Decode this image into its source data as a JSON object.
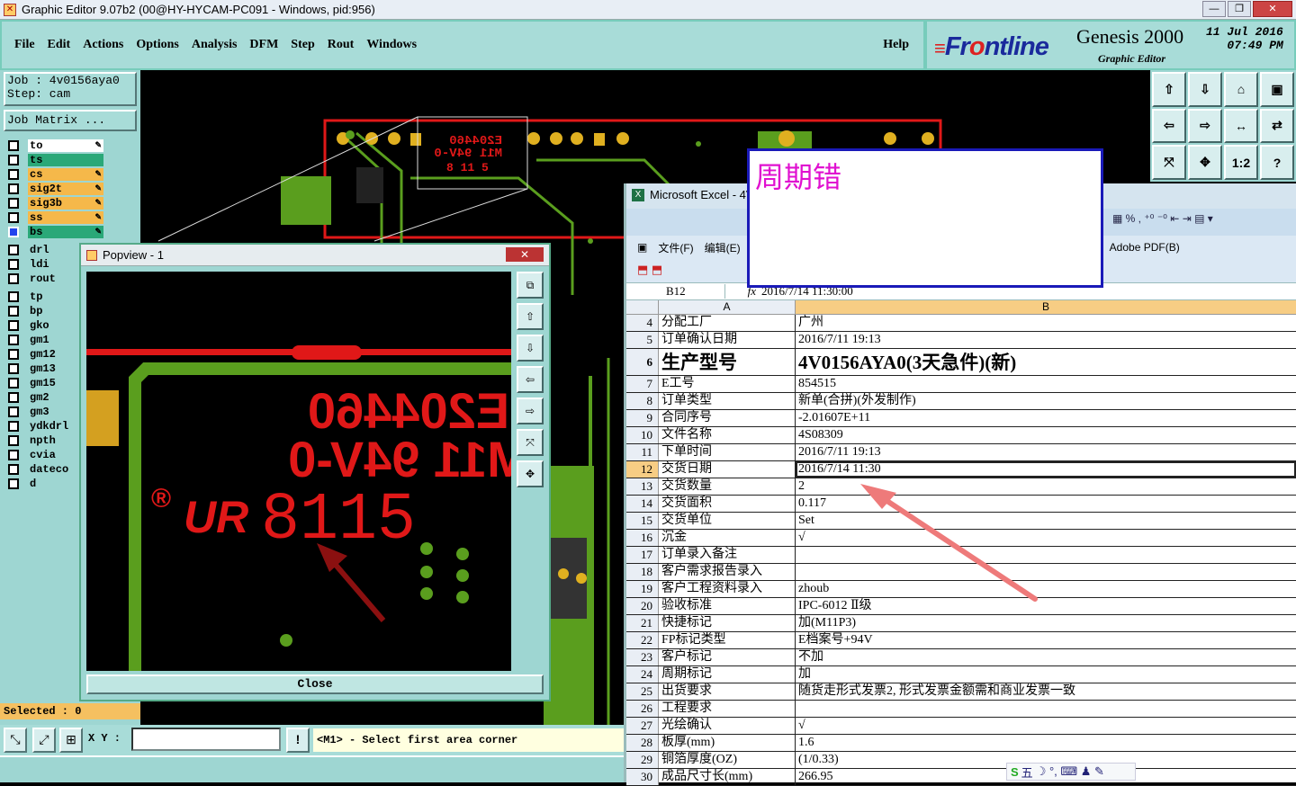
{
  "window": {
    "title": "Graphic Editor 9.07b2 (00@HY-HYCAM-PC091 - Windows, pid:956)",
    "minimize": "—",
    "restore": "❐",
    "close": "✕"
  },
  "menu": {
    "items": [
      "File",
      "Edit",
      "Actions",
      "Options",
      "Analysis",
      "DFM",
      "Step",
      "Rout",
      "Windows"
    ],
    "help": "Help"
  },
  "brand": {
    "logo_prefix": "Fr",
    "logo_o": "o",
    "logo_suffix": "ntline",
    "product": "Genesis 2000",
    "subtitle": "Graphic Editor",
    "date_line1": "11 Jul 2016",
    "date_line2": "07:49 PM"
  },
  "job": {
    "label": "Job : 4v0156aya0",
    "step": "Step: cam",
    "matrix": "Job Matrix ..."
  },
  "layers": [
    {
      "name": "to",
      "style": "white",
      "edit": true
    },
    {
      "name": "ts",
      "style": "green",
      "edit": false
    },
    {
      "name": "cs",
      "style": "active",
      "edit": true
    },
    {
      "name": "sig2t",
      "style": "active",
      "edit": true
    },
    {
      "name": "sig3b",
      "style": "active",
      "edit": true
    },
    {
      "name": "ss",
      "style": "active",
      "edit": true
    },
    {
      "name": "bs",
      "style": "green",
      "edit": true,
      "checked": true
    },
    {
      "name": "drl",
      "style": "none"
    },
    {
      "name": "ldi",
      "style": "none"
    },
    {
      "name": "rout",
      "style": "none"
    },
    {
      "name": "tp",
      "style": "none"
    },
    {
      "name": "bp",
      "style": "none"
    },
    {
      "name": "gko",
      "style": "none"
    },
    {
      "name": "gm1",
      "style": "none"
    },
    {
      "name": "gm12",
      "style": "none"
    },
    {
      "name": "gm13",
      "style": "none"
    },
    {
      "name": "gm15",
      "style": "none"
    },
    {
      "name": "gm2",
      "style": "none"
    },
    {
      "name": "gm3",
      "style": "none"
    },
    {
      "name": "ydkdrl",
      "style": "none"
    },
    {
      "name": "npth",
      "style": "none"
    },
    {
      "name": "cvia",
      "style": "none"
    },
    {
      "name": "dateco",
      "style": "none"
    },
    {
      "name": "d",
      "style": "none"
    }
  ],
  "status": {
    "selected": "Selected : 0",
    "xy_label": "X Y :",
    "xy_value": "",
    "message": "<M1> - Select first area corner",
    "alert": "!"
  },
  "popview": {
    "title": "Popview - 1",
    "close_x": "✕",
    "close_button": "Close",
    "marking_line1": "E204460",
    "marking_line2": "M11 94V-0",
    "marking_line3": "8115",
    "ul_mark": "UR",
    "reg_mark": "®"
  },
  "canvas_marking": {
    "line1": "E204460",
    "line2": "M11 94V-0",
    "small": "8 11 5"
  },
  "excel": {
    "title": "Microsoft Excel - 4V",
    "menu": [
      "文件(F)",
      "编辑(E)"
    ],
    "adobe": "Adobe PDF(B)",
    "namebox": "B12",
    "fx": "fx",
    "formula": "2016/7/14  11:30:00",
    "col_a": "A",
    "col_b": "B",
    "rows": [
      {
        "n": "4",
        "a": "分配工厂",
        "b": "广州"
      },
      {
        "n": "5",
        "a": "订单确认日期",
        "b": "2016/7/11 19:13"
      },
      {
        "n": "6",
        "a": "生产型号",
        "b": "4V0156AYA0(3天急件)(新)",
        "tall": true
      },
      {
        "n": "7",
        "a": "E工号",
        "b": "854515"
      },
      {
        "n": "8",
        "a": "订单类型",
        "b": "新单(合拼)(外发制作)"
      },
      {
        "n": "9",
        "a": "合同序号",
        "b": "-2.01607E+11"
      },
      {
        "n": "10",
        "a": "文件名称",
        "b": "4S08309"
      },
      {
        "n": "11",
        "a": "下单时间",
        "b": "2016/7/11 19:13"
      },
      {
        "n": "12",
        "a": "交货日期",
        "b": "2016/7/14 11:30",
        "sel": true
      },
      {
        "n": "13",
        "a": "交货数量",
        "b": "2"
      },
      {
        "n": "14",
        "a": "交货面积",
        "b": "0.117"
      },
      {
        "n": "15",
        "a": "交货单位",
        "b": "Set"
      },
      {
        "n": "16",
        "a": "沉金",
        "b": "√"
      },
      {
        "n": "17",
        "a": "订单录入备注",
        "b": ""
      },
      {
        "n": "18",
        "a": "客户需求报告录入",
        "b": ""
      },
      {
        "n": "19",
        "a": "客户工程资料录入",
        "b": "zhoub"
      },
      {
        "n": "20",
        "a": "验收标准",
        "b": "IPC-6012 Ⅱ级"
      },
      {
        "n": "21",
        "a": "快捷标记",
        "b": "加(M11P3)"
      },
      {
        "n": "22",
        "a": "FP标记类型",
        "b": "E档案号+94V"
      },
      {
        "n": "23",
        "a": "客户标记",
        "b": "不加"
      },
      {
        "n": "24",
        "a": "周期标记",
        "b": "加"
      },
      {
        "n": "25",
        "a": "出货要求",
        "b": "随货走形式发票2,  形式发票金额需和商业发票一致"
      },
      {
        "n": "26",
        "a": "工程要求",
        "b": ""
      },
      {
        "n": "27",
        "a": "光绘确认",
        "b": "√"
      },
      {
        "n": "28",
        "a": "板厚(mm)",
        "b": "1.6"
      },
      {
        "n": "29",
        "a": "铜箔厚度(OZ)",
        "b": " (1/0.33)"
      },
      {
        "n": "30",
        "a": "成品尺寸长(mm)",
        "b": "266.95"
      }
    ]
  },
  "note": {
    "text": "周期错"
  },
  "ime": {
    "label": "五",
    "extras": "☽ °, ⌨ ♟ ✎"
  },
  "colors": {
    "panel": "#a8dcd8",
    "trace": "#5a9e1e",
    "copper_red": "#e01818",
    "pad_yellow": "#e0b020",
    "note_text": "#e010d0",
    "arrow": "#ee7a7a"
  }
}
